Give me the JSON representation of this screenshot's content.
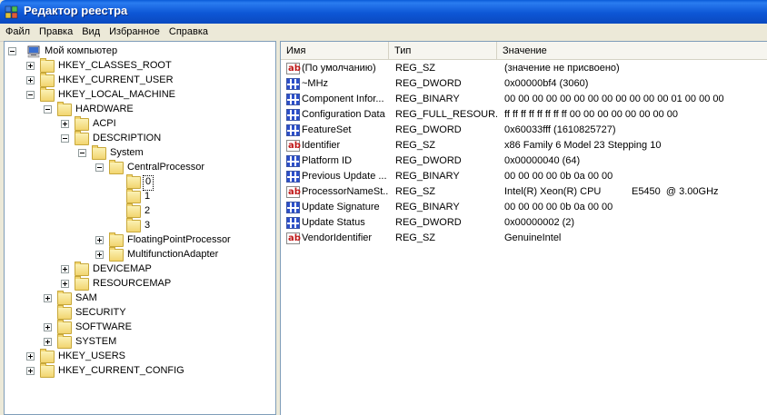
{
  "window": {
    "title": "Редактор реестра"
  },
  "menu": [
    "Файл",
    "Правка",
    "Вид",
    "Избранное",
    "Справка"
  ],
  "tree": {
    "root": "Мой компьютер",
    "hkcr": "HKEY_CLASSES_ROOT",
    "hkcu": "HKEY_CURRENT_USER",
    "hklm": "HKEY_LOCAL_MACHINE",
    "hardware": "HARDWARE",
    "acpi": "ACPI",
    "description": "DESCRIPTION",
    "system": "System",
    "centralprocessor": "CentralProcessor",
    "cpu0": "0",
    "cpu1": "1",
    "cpu2": "2",
    "cpu3": "3",
    "fpp": "FloatingPointProcessor",
    "mfa": "MultifunctionAdapter",
    "devicemap": "DEVICEMAP",
    "resourcemap": "RESOURCEMAP",
    "sam": "SAM",
    "security": "SECURITY",
    "software": "SOFTWARE",
    "system2": "SYSTEM",
    "hku": "HKEY_USERS",
    "hkcc": "HKEY_CURRENT_CONFIG"
  },
  "list": {
    "headers": {
      "name": "Имя",
      "type": "Тип",
      "value": "Значение"
    },
    "rows": [
      {
        "icon": "string-value-icon",
        "name": "(По умолчанию)",
        "type": "REG_SZ",
        "value": "(значение не присвоено)"
      },
      {
        "icon": "binary-value-icon",
        "name": "~MHz",
        "type": "REG_DWORD",
        "value": "0x00000bf4 (3060)"
      },
      {
        "icon": "binary-value-icon",
        "name": "Component Infor...",
        "type": "REG_BINARY",
        "value": "00 00 00 00 00 00 00 00 00 00 00 00 01 00 00 00"
      },
      {
        "icon": "binary-value-icon",
        "name": "Configuration Data",
        "type": "REG_FULL_RESOUR...",
        "value": "ff ff ff ff ff ff ff ff 00 00 00 00 00 00 00 00"
      },
      {
        "icon": "binary-value-icon",
        "name": "FeatureSet",
        "type": "REG_DWORD",
        "value": "0x60033fff (1610825727)"
      },
      {
        "icon": "string-value-icon",
        "name": "Identifier",
        "type": "REG_SZ",
        "value": "x86 Family 6 Model 23 Stepping 10"
      },
      {
        "icon": "binary-value-icon",
        "name": "Platform ID",
        "type": "REG_DWORD",
        "value": "0x00000040 (64)"
      },
      {
        "icon": "binary-value-icon",
        "name": "Previous Update ...",
        "type": "REG_BINARY",
        "value": "00 00 00 00 0b 0a 00 00"
      },
      {
        "icon": "string-value-icon",
        "name": "ProcessorNameSt...",
        "type": "REG_SZ",
        "value": "Intel(R) Xeon(R) CPU           E5450  @ 3.00GHz"
      },
      {
        "icon": "binary-value-icon",
        "name": "Update Signature",
        "type": "REG_BINARY",
        "value": "00 00 00 00 0b 0a 00 00"
      },
      {
        "icon": "binary-value-icon",
        "name": "Update Status",
        "type": "REG_DWORD",
        "value": "0x00000002 (2)"
      },
      {
        "icon": "string-value-icon",
        "name": "VendorIdentifier",
        "type": "REG_SZ",
        "value": "GenuineIntel"
      }
    ]
  },
  "icons": {
    "app": "registry-editor-icon",
    "computer": "computer-icon",
    "folder": "folder-icon",
    "open_folder": "open-folder-icon"
  },
  "colors": {
    "titlebar": "#0a5bd8",
    "selection_border": "#000000"
  }
}
